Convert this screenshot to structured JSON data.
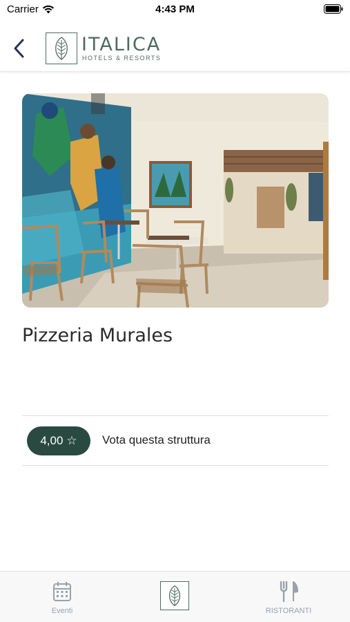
{
  "status_bar": {
    "carrier": "Carrier",
    "time": "4:43 PM"
  },
  "header": {
    "logo": {
      "name": "ITALICA",
      "subtitle": "HOTELS & RESORTS"
    },
    "back_icon": "chevron-left-icon"
  },
  "hero": {
    "image": "restaurant-interior-with-mural-photo"
  },
  "restaurant": {
    "name": "Pizzeria Murales"
  },
  "rating": {
    "value": "4,00",
    "star": "☆",
    "vote_label": "Vota questa struttura"
  },
  "tabbar": {
    "tabs": [
      {
        "label": "Eventi",
        "icon": "calendar-icon"
      },
      {
        "label": "",
        "icon": "italica-logo-icon"
      },
      {
        "label": "RISTORANTI",
        "icon": "fork-knife-icon"
      }
    ]
  },
  "colors": {
    "brand": "#4e6a5e",
    "badge": "#2a4a41",
    "tab_inactive": "#9aa1a9",
    "back_arrow": "#2b2f5a"
  }
}
